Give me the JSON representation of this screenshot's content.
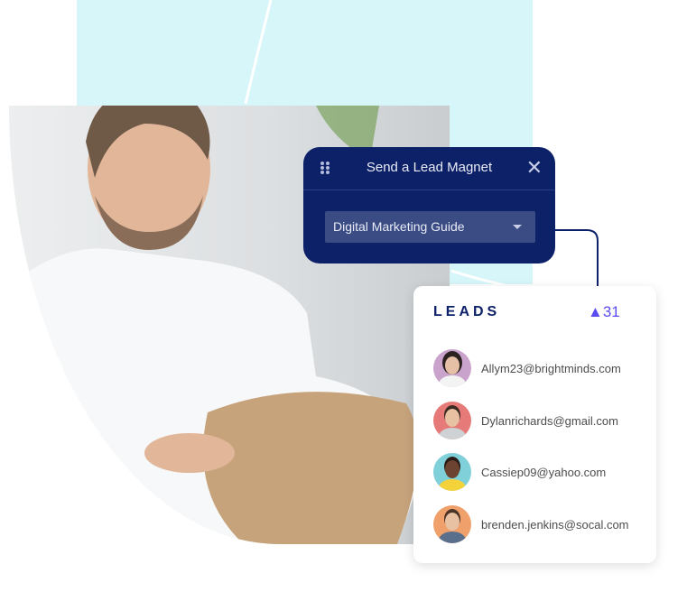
{
  "modal": {
    "title": "Send a Lead Magnet",
    "dropdown_value": "Digital Marketing Guide",
    "drag_icon": "grip-icon",
    "close_icon": "close-icon"
  },
  "leads": {
    "title": "LEADS",
    "trend_icon": "triangle-up-icon",
    "count": "31",
    "accent": "#5b4cf0",
    "items": [
      {
        "email": "Allym23@brightminds.com",
        "avatar_bg": "#c9a3cb"
      },
      {
        "email": "Dylanrichards@gmail.com",
        "avatar_bg": "#e57a78"
      },
      {
        "email": "Cassiep09@yahoo.com",
        "avatar_bg": "#7fd0d8"
      },
      {
        "email": "brenden.jenkins@socal.com",
        "avatar_bg": "#f0a06a"
      }
    ]
  },
  "colors": {
    "navy": "#0d2169",
    "cyan": "#d7f6fa"
  }
}
